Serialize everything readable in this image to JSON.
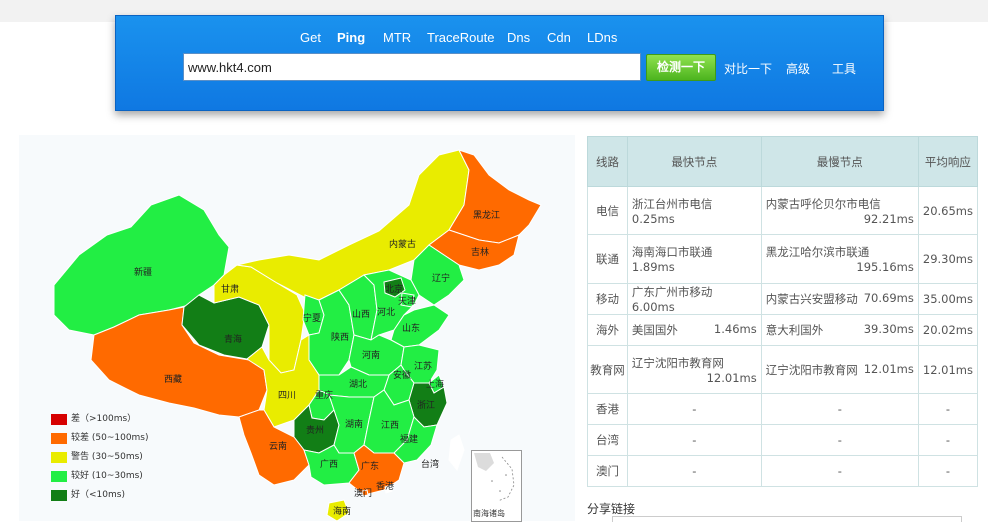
{
  "nav": {
    "items": [
      "Get",
      "Ping",
      "MTR",
      "TraceRoute",
      "Dns",
      "Cdn",
      "LDns"
    ],
    "active": "Ping"
  },
  "search": {
    "value": "www.hkt4.com",
    "button": "检测一下"
  },
  "header_links": {
    "compare": "对比一下",
    "advanced": "高级",
    "tools": "工具"
  },
  "map": {
    "colors": {
      "bad": "#d60000",
      "poor": "#ff6a00",
      "warn": "#e9ec00",
      "good": "#22ee44",
      "best": "#127e16"
    },
    "provinces": [
      {
        "name": "新疆",
        "level": "good"
      },
      {
        "name": "西藏",
        "level": "poor"
      },
      {
        "name": "青海",
        "level": "best"
      },
      {
        "name": "甘肃",
        "level": "warn"
      },
      {
        "name": "内蒙古",
        "level": "warn"
      },
      {
        "name": "黑龙江",
        "level": "poor"
      },
      {
        "name": "吉林",
        "level": "poor"
      },
      {
        "name": "辽宁",
        "level": "good"
      },
      {
        "name": "宁夏",
        "level": "good"
      },
      {
        "name": "陕西",
        "level": "good"
      },
      {
        "name": "山西",
        "level": "good"
      },
      {
        "name": "河北",
        "level": "good"
      },
      {
        "name": "北京",
        "level": "best"
      },
      {
        "name": "天津",
        "level": "good"
      },
      {
        "name": "山东",
        "level": "good"
      },
      {
        "name": "河南",
        "level": "good"
      },
      {
        "name": "江苏",
        "level": "good"
      },
      {
        "name": "安徽",
        "level": "good"
      },
      {
        "name": "上海",
        "level": "good"
      },
      {
        "name": "湖北",
        "level": "good"
      },
      {
        "name": "四川",
        "level": "warn"
      },
      {
        "name": "重庆",
        "level": "good"
      },
      {
        "name": "浙江",
        "level": "best"
      },
      {
        "name": "贵州",
        "level": "best"
      },
      {
        "name": "湖南",
        "level": "good"
      },
      {
        "name": "江西",
        "level": "good"
      },
      {
        "name": "福建",
        "level": "good"
      },
      {
        "name": "云南",
        "level": "poor"
      },
      {
        "name": "广西",
        "level": "good"
      },
      {
        "name": "广东",
        "level": "poor"
      },
      {
        "name": "台湾",
        "level": "none"
      },
      {
        "name": "香港",
        "level": "none"
      },
      {
        "name": "澳门",
        "level": "poor"
      },
      {
        "name": "海南",
        "level": "warn"
      }
    ],
    "nanhai_caption": "南海诸岛"
  },
  "legend": [
    {
      "label": "差（>100ms）",
      "color": "#d60000"
    },
    {
      "label": "较差 (50~100ms)",
      "color": "#ff6a00"
    },
    {
      "label": "警告 (30~50ms)",
      "color": "#e9ec00"
    },
    {
      "label": "较好 (10~30ms)",
      "color": "#22ee44"
    },
    {
      "label": "好（<10ms)",
      "color": "#127e16"
    }
  ],
  "table": {
    "headers": [
      "线路",
      "最快节点",
      "最慢节点",
      "平均响应"
    ],
    "rows": [
      {
        "line": "电信",
        "fast": "浙江台州市电信",
        "fast_ms": "0.25ms",
        "slow": "内蒙古呼伦贝尔市电信",
        "slow_ms": "92.21ms",
        "avg": "20.65ms"
      },
      {
        "line": "联通",
        "fast": "海南海口市联通",
        "fast_ms": "1.89ms",
        "slow": "黑龙江哈尔滨市联通",
        "slow_ms": "195.16ms",
        "avg": "29.30ms"
      },
      {
        "line": "移动",
        "fast": "广东广州市移动",
        "fast_ms": "6.00ms",
        "slow": "内蒙古兴安盟移动",
        "slow_ms": "70.69ms",
        "avg": "35.00ms"
      },
      {
        "line": "海外",
        "fast": "美国国外",
        "fast_ms": "1.46ms",
        "slow": "意大利国外",
        "slow_ms": "39.30ms",
        "avg": "20.02ms"
      },
      {
        "line": "教育网",
        "fast": "辽宁沈阳市教育网",
        "fast_ms": "12.01ms",
        "slow": "辽宁沈阳市教育网",
        "slow_ms": "12.01ms",
        "avg": "12.01ms"
      },
      {
        "line": "香港",
        "fast": "-",
        "fast_ms": "",
        "slow": "-",
        "slow_ms": "",
        "avg": "-"
      },
      {
        "line": "台湾",
        "fast": "-",
        "fast_ms": "",
        "slow": "-",
        "slow_ms": "",
        "avg": "-"
      },
      {
        "line": "澳门",
        "fast": "-",
        "fast_ms": "",
        "slow": "-",
        "slow_ms": "",
        "avg": "-"
      }
    ]
  },
  "share": {
    "label": "分享链接"
  }
}
